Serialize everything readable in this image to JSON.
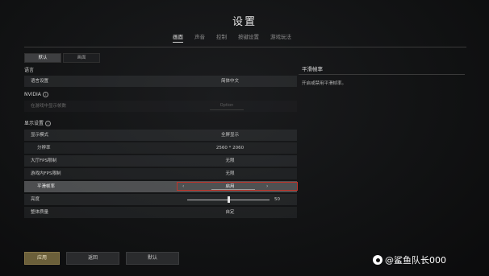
{
  "title": "设置",
  "top_tabs": [
    "画面",
    "声音",
    "控制",
    "按键设置",
    "游戏玩法"
  ],
  "sub_tabs": [
    "默认",
    "画面"
  ],
  "sections": {
    "language": {
      "header": "语言",
      "row_label": "语言设置",
      "row_value": "简体中文"
    },
    "nvidia": {
      "header": "NVIDIA",
      "row_label": "在游戏中显示帧数",
      "row_value": "Option"
    },
    "display": {
      "header": "显示设置",
      "rows": [
        {
          "label": "显示模式",
          "value": "全屏显示"
        },
        {
          "label": "分辨率",
          "value": "2560 * 2060"
        },
        {
          "label": "大厅FPS限制",
          "value": "无限"
        },
        {
          "label": "游戏内FPS限制",
          "value": "无限"
        },
        {
          "label": "平滑帧率",
          "value": "启用"
        },
        {
          "label": "亮度",
          "value": "50"
        },
        {
          "label": "整体质量",
          "value": "自定"
        }
      ],
      "brightness_level": 0.5
    }
  },
  "right_panel": {
    "title": "平滑帧率",
    "description": "开启或禁用平滑帧率。"
  },
  "buttons": {
    "apply": "应用",
    "back": "返回",
    "default": "默认"
  },
  "watermark": "@鲨鱼队长000",
  "colors": {
    "highlight_border": "#c0342a",
    "apply_button": "#6b5f3a"
  }
}
